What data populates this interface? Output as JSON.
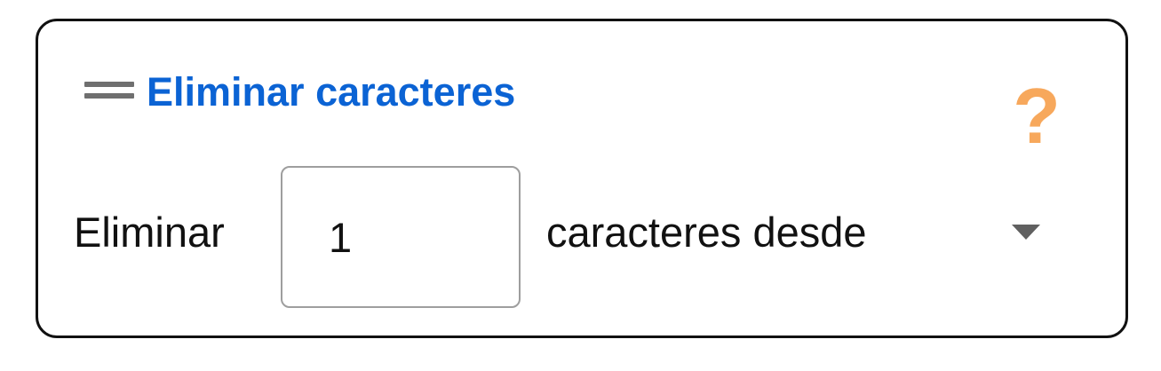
{
  "block": {
    "title": "Eliminar caracteres",
    "help_icon": "?",
    "label_before": "Eliminar",
    "count_value": "1",
    "label_after": "caracteres desde"
  },
  "icons": {
    "drag_handle": "drag-handle-icon",
    "help": "question-mark-icon",
    "dropdown": "chevron-down-icon"
  },
  "colors": {
    "title": "#0b63d4",
    "help_icon": "#f7a85c",
    "border": "#111111",
    "handle": "#6f6f6f"
  }
}
